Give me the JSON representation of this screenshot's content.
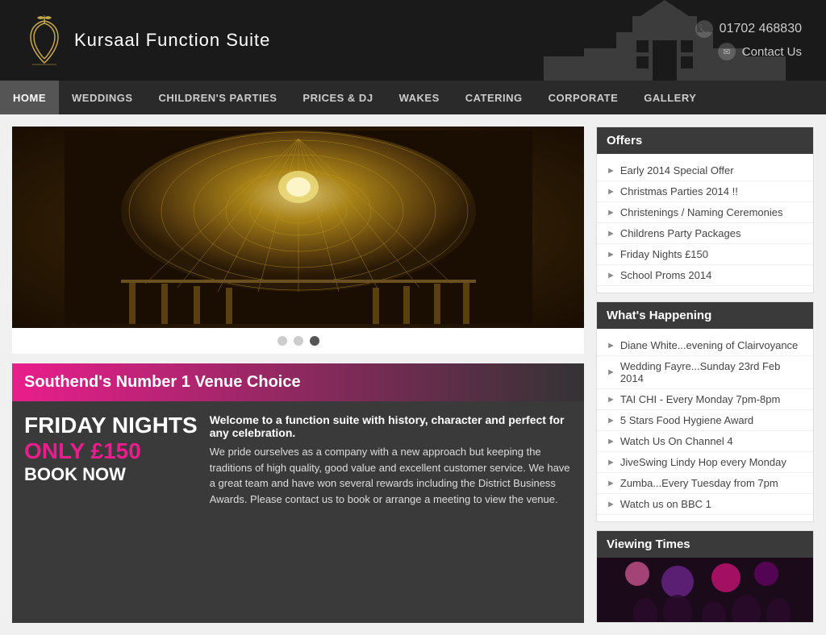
{
  "header": {
    "logo_text": "Kursaal Function Suite",
    "phone": "01702 468830",
    "contact_label": "Contact Us"
  },
  "nav": {
    "items": [
      {
        "label": "HOME",
        "active": true
      },
      {
        "label": "WEDDINGS",
        "active": false
      },
      {
        "label": "CHILDREN'S PARTIES",
        "active": false
      },
      {
        "label": "PRICES & DJ",
        "active": false
      },
      {
        "label": "WAKES",
        "active": false
      },
      {
        "label": "CATERING",
        "active": false
      },
      {
        "label": "CORPORATE",
        "active": false
      },
      {
        "label": "GALLERY",
        "active": false
      }
    ]
  },
  "slider": {
    "dots": [
      {
        "active": false
      },
      {
        "active": false
      },
      {
        "active": true
      }
    ]
  },
  "promo_bar": {
    "text": "Southend's Number 1 Venue Choice"
  },
  "friday_nights": {
    "line1": "FRIDAY NIGHTS",
    "line2": "ONLY £150",
    "line3": "BOOK NOW"
  },
  "welcome": {
    "title": "Welcome to a function suite with history, character and perfect for any celebration.",
    "body": "We pride ourselves as a company with a new approach but keeping the traditions of high quality, good value and excellent customer service. We have a great team and have won several rewards including the District Business Awards. Please contact us to book or arrange a meeting to view the venue."
  },
  "offers": {
    "header": "Offers",
    "items": [
      {
        "label": "Early 2014 Special Offer"
      },
      {
        "label": "Christmas Parties 2014 !!"
      },
      {
        "label": "Christenings / Naming Ceremonies"
      },
      {
        "label": "Childrens Party Packages"
      },
      {
        "label": "Friday Nights £150"
      },
      {
        "label": "School Proms 2014"
      }
    ]
  },
  "whats_happening": {
    "header": "What's Happening",
    "items": [
      {
        "label": "Diane White...evening of Clairvoyance"
      },
      {
        "label": "Wedding Fayre...Sunday 23rd Feb 2014"
      },
      {
        "label": "TAI CHI - Every Monday 7pm-8pm"
      },
      {
        "label": "5 Stars Food Hygiene Award"
      },
      {
        "label": "Watch Us On Channel 4"
      },
      {
        "label": "JiveSwing Lindy Hop every Monday"
      },
      {
        "label": "Zumba...Every Tuesday from 7pm"
      },
      {
        "label": "Watch us on BBC 1"
      }
    ]
  },
  "viewing_times": {
    "header": "Viewing Times"
  }
}
